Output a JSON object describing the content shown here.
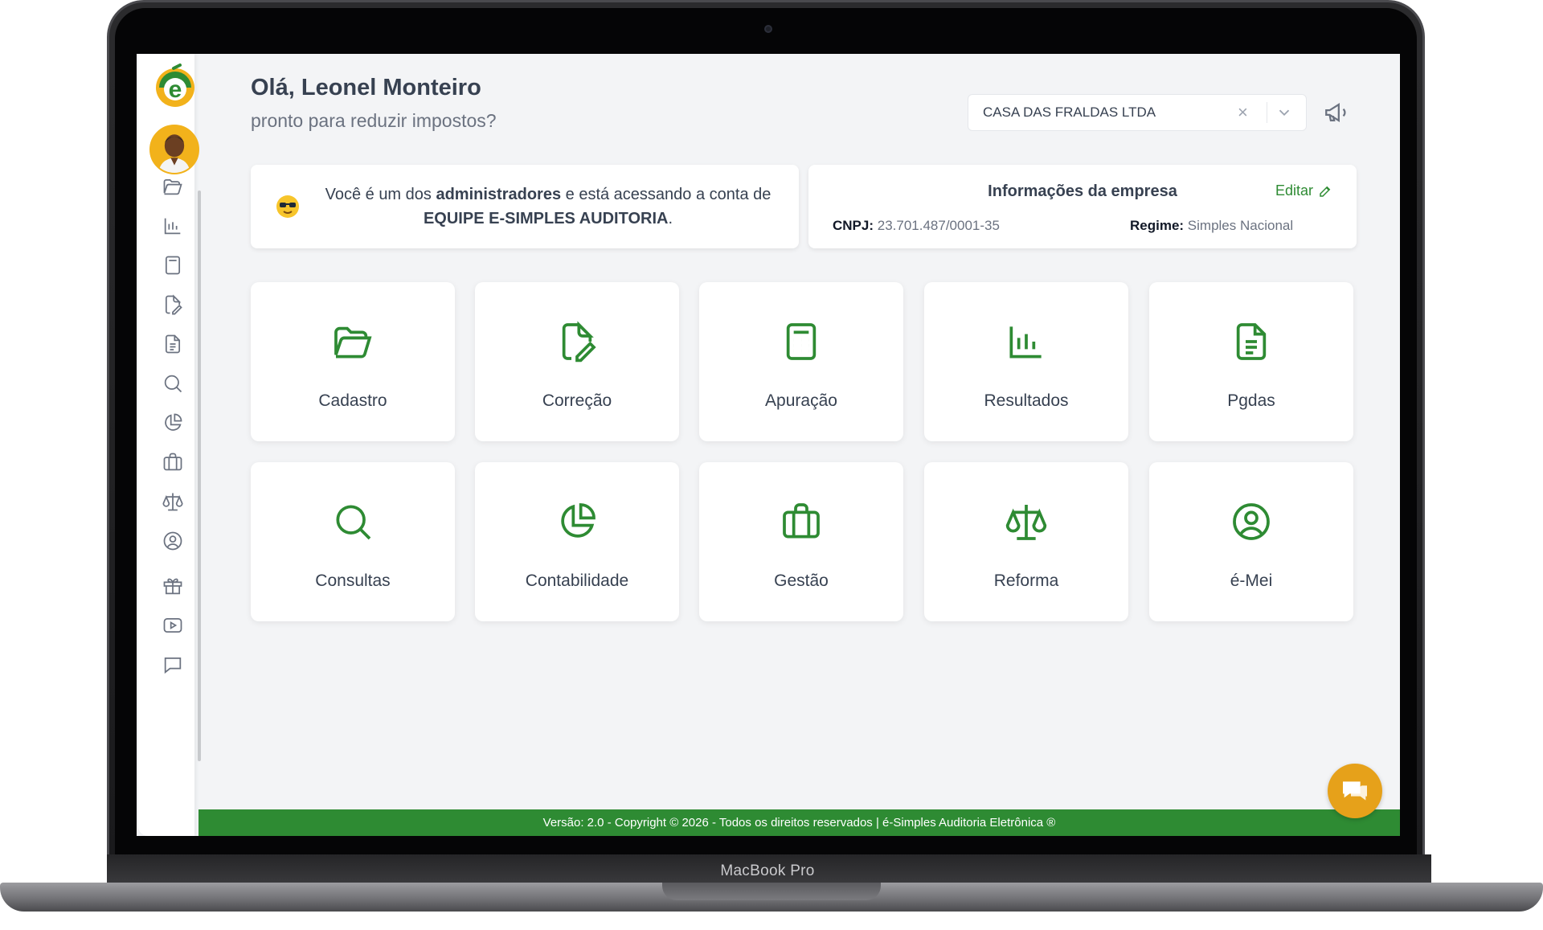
{
  "device": {
    "brand_label": "MacBook Pro"
  },
  "header": {
    "greeting": "Olá, Leonel Monteiro",
    "subtitle": "pronto para reduzir impostos?"
  },
  "company_select": {
    "value": "CASA DAS FRALDAS LTDA",
    "clear_symbol": "×"
  },
  "admin_notice": {
    "part1": "Você é um dos ",
    "bold1": "administradores",
    "part2": " e está acessando a conta de ",
    "bold2": "EQUIPE E-SIMPLES AUDITORIA",
    "part3": "."
  },
  "company_info": {
    "title": "Informações da empresa",
    "edit_label": "Editar",
    "cnpj_label": "CNPJ:",
    "cnpj_value": " 23.701.487/0001-35",
    "regime_label": "Regime:",
    "regime_value": " Simples Nacional"
  },
  "sidebar": {
    "icons": [
      "folder-icon",
      "bar-chart-icon",
      "calculator-icon",
      "file-edit-icon",
      "document-icon",
      "search-icon",
      "pie-chart-icon",
      "briefcase-icon",
      "scale-icon",
      "user-circle-icon",
      "gift-icon",
      "video-icon",
      "message-icon"
    ]
  },
  "tiles": [
    {
      "label": "Cadastro",
      "icon": "folder-icon"
    },
    {
      "label": "Correção",
      "icon": "file-edit-icon"
    },
    {
      "label": "Apuração",
      "icon": "calculator-icon"
    },
    {
      "label": "Resultados",
      "icon": "bar-chart-icon"
    },
    {
      "label": "Pgdas",
      "icon": "document-icon"
    },
    {
      "label": "Consultas",
      "icon": "search-icon"
    },
    {
      "label": "Contabilidade",
      "icon": "pie-chart-icon"
    },
    {
      "label": "Gestão",
      "icon": "briefcase-icon"
    },
    {
      "label": "Reforma",
      "icon": "scale-icon"
    },
    {
      "label": "é-Mei",
      "icon": "user-circle-icon"
    }
  ],
  "footer": {
    "text": "Versão: 2.0 - Copyright © 2026 - Todos os direitos reservados | é-Simples Auditoria Eletrônica ®"
  },
  "colors": {
    "accent_green": "#2e8b33",
    "chat_orange": "#e6a11a",
    "logo_yellow": "#f2b21b"
  }
}
